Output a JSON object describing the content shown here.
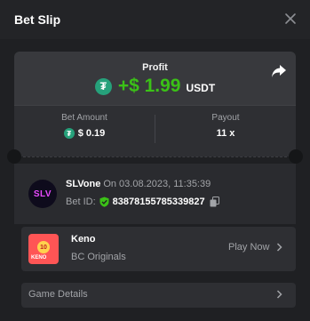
{
  "header": {
    "title": "Bet Slip",
    "close_icon": "close-icon"
  },
  "profit": {
    "label": "Profit",
    "coin_symbol": "₮",
    "value": "+$ 1.99",
    "currency": "USDT",
    "share_icon": "share-arrow-icon"
  },
  "stats": {
    "bet_amount_label": "Bet Amount",
    "bet_amount_value": "$ 0.19",
    "payout_label": "Payout",
    "payout_value": "11 x"
  },
  "user": {
    "avatar_text": "SLV",
    "username": "SLVone",
    "on_text": "On 03.08.2023, 11:35:39",
    "bet_id_label": "Bet ID:",
    "bet_id_value": "83878155785339827"
  },
  "game": {
    "name": "Keno",
    "provider": "BC Originals",
    "play_label": "Play Now",
    "thumb_text": "KENO"
  },
  "details": {
    "label": "Game Details"
  },
  "colors": {
    "profit_green": "#3bc117",
    "usdt_teal": "#26a17b",
    "background": "#1f2023",
    "card": "#38393d",
    "muted_text": "#a2a4a8"
  }
}
